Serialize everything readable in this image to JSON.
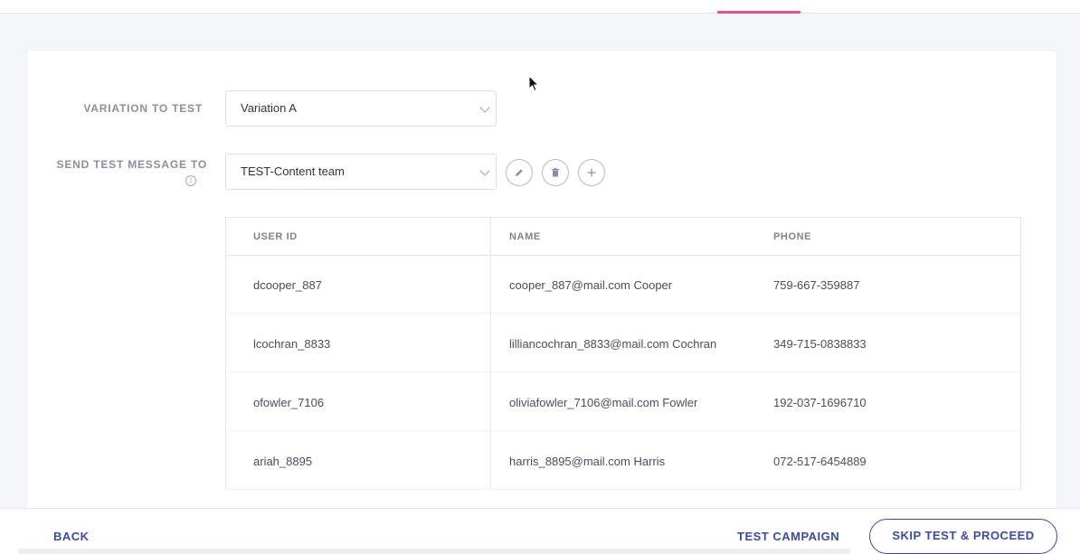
{
  "form": {
    "variation_label": "VARIATION TO TEST",
    "variation_value": "Variation A",
    "send_label_line1": "SEND TEST MESSAGE TO",
    "info_icon_glyph": "i",
    "segment_value": "TEST-Content team",
    "icons": [
      "pencil-icon",
      "trash-icon",
      "plus-icon"
    ]
  },
  "table": {
    "headers": [
      "USER ID",
      "NAME",
      "PHONE"
    ],
    "rows": [
      {
        "user_id": "dcooper_887",
        "name": "cooper_887@mail.com Cooper",
        "phone": "759-667-359887"
      },
      {
        "user_id": "lcochran_8833",
        "name": "lilliancochran_8833@mail.com Cochran",
        "phone": "349-715-0838833"
      },
      {
        "user_id": "ofowler_7106",
        "name": "oliviafowler_7106@mail.com Fowler",
        "phone": "192-037-1696710"
      },
      {
        "user_id": "ariah_8895",
        "name": "harris_8895@mail.com Harris",
        "phone": "072-517-6454889"
      }
    ]
  },
  "footer": {
    "back_label": "BACK",
    "test_label": "TEST CAMPAIGN",
    "skip_label": "SKIP TEST & PROCEED"
  },
  "colors": {
    "accent": "#3a4aa8",
    "tab_underline": "#e8508a"
  }
}
